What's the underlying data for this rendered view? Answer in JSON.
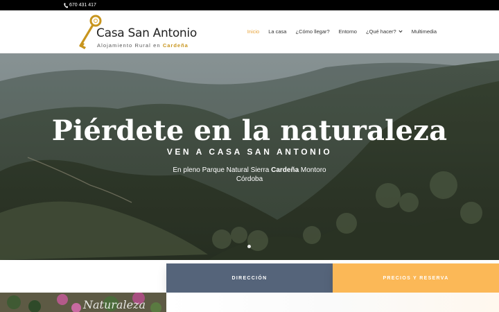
{
  "topbar": {
    "phone": "670 431 417",
    "phone_icon": "phone-icon"
  },
  "brand": {
    "name": "Casa San Antonio",
    "tagline": "Alojamiento Rural en",
    "tagline_accent": "Cardeña",
    "logo_icon": "key-icon"
  },
  "nav": {
    "items": [
      {
        "label": "Inicio",
        "active": true
      },
      {
        "label": "La casa"
      },
      {
        "label": "¿Cómo llegar?"
      },
      {
        "label": "Entorno"
      },
      {
        "label": "¿Qué hacer?",
        "dropdown": true
      },
      {
        "label": "Multimedia"
      }
    ]
  },
  "hero": {
    "title": "Piérdete en la naturaleza",
    "subtitle": "VEN A CASA SAN ANTONIO",
    "desc_prefix": "En pleno Parque Natural Sierra ",
    "desc_bold": "Cardeña",
    "desc_suffix": " Montoro",
    "desc_line2": "Córdoba"
  },
  "buttons": {
    "direccion": "DIRECCIÓN",
    "precios": "PRECIOS Y RESERVA"
  },
  "thumbnail": {
    "caption": "Naturaleza"
  },
  "colors": {
    "accent": "#e8a33a",
    "direccion_bg": "#55647a",
    "precios_bg": "#fbb857"
  }
}
